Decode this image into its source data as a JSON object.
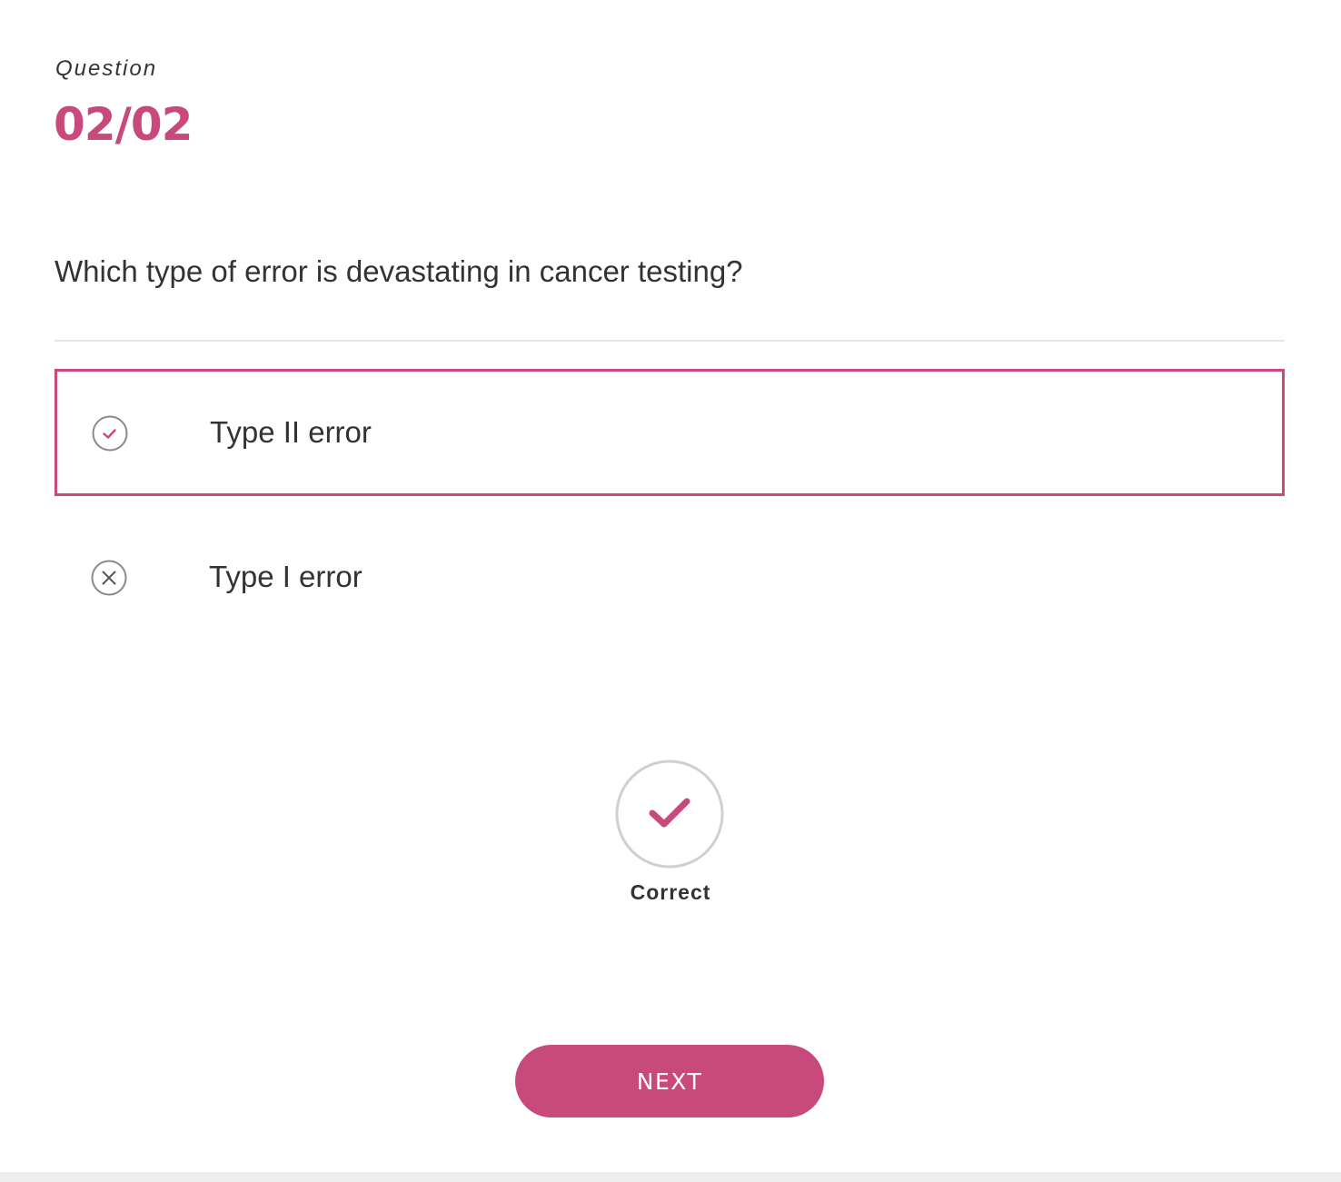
{
  "header": {
    "label": "Question",
    "counter": "02/02"
  },
  "question": {
    "text": "Which type of error is devastating in cancer testing?"
  },
  "options": [
    {
      "label": "Type II error",
      "state": "correct-selected",
      "icon": "check-circle-icon"
    },
    {
      "label": "Type I error",
      "state": "incorrect",
      "icon": "x-circle-icon"
    }
  ],
  "result": {
    "icon": "check-icon",
    "text": "Correct"
  },
  "actions": {
    "next_label": "NEXT"
  },
  "colors": {
    "accent": "#c84a7c",
    "text": "#333333",
    "divider": "#e6e6e6",
    "icon_gray": "#8a8a8a"
  }
}
